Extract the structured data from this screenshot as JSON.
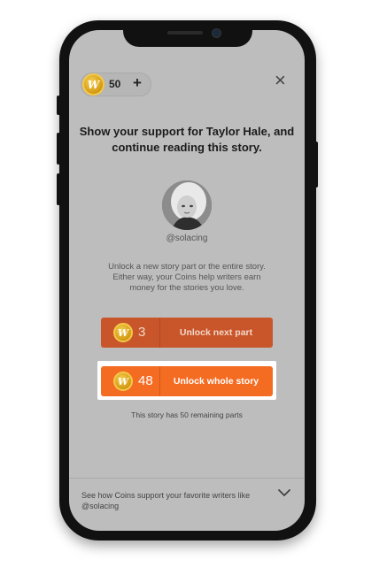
{
  "header": {
    "coin_balance": "50",
    "add_coins_label": "+",
    "close_label": "×"
  },
  "headline": "Show your support for Taylor Hale, and continue reading this story.",
  "author": {
    "handle": "@solacing"
  },
  "description": "Unlock a new story part or the entire story. Either way, your Coins help writers earn money for the stories you love.",
  "unlock_next": {
    "cost": "3",
    "label": "Unlock next part"
  },
  "unlock_whole": {
    "cost": "48",
    "label": "Unlock whole story"
  },
  "remaining_text": "This story has 50 remaining parts",
  "footer": {
    "text": "See how Coins support your favorite writers like @solacing"
  },
  "coin_glyph": "W",
  "colors": {
    "unlock_next": "#c9562a",
    "unlock_whole": "#f46b22",
    "coin": "#e0aa1e",
    "overlay": "#bdbdbd"
  }
}
